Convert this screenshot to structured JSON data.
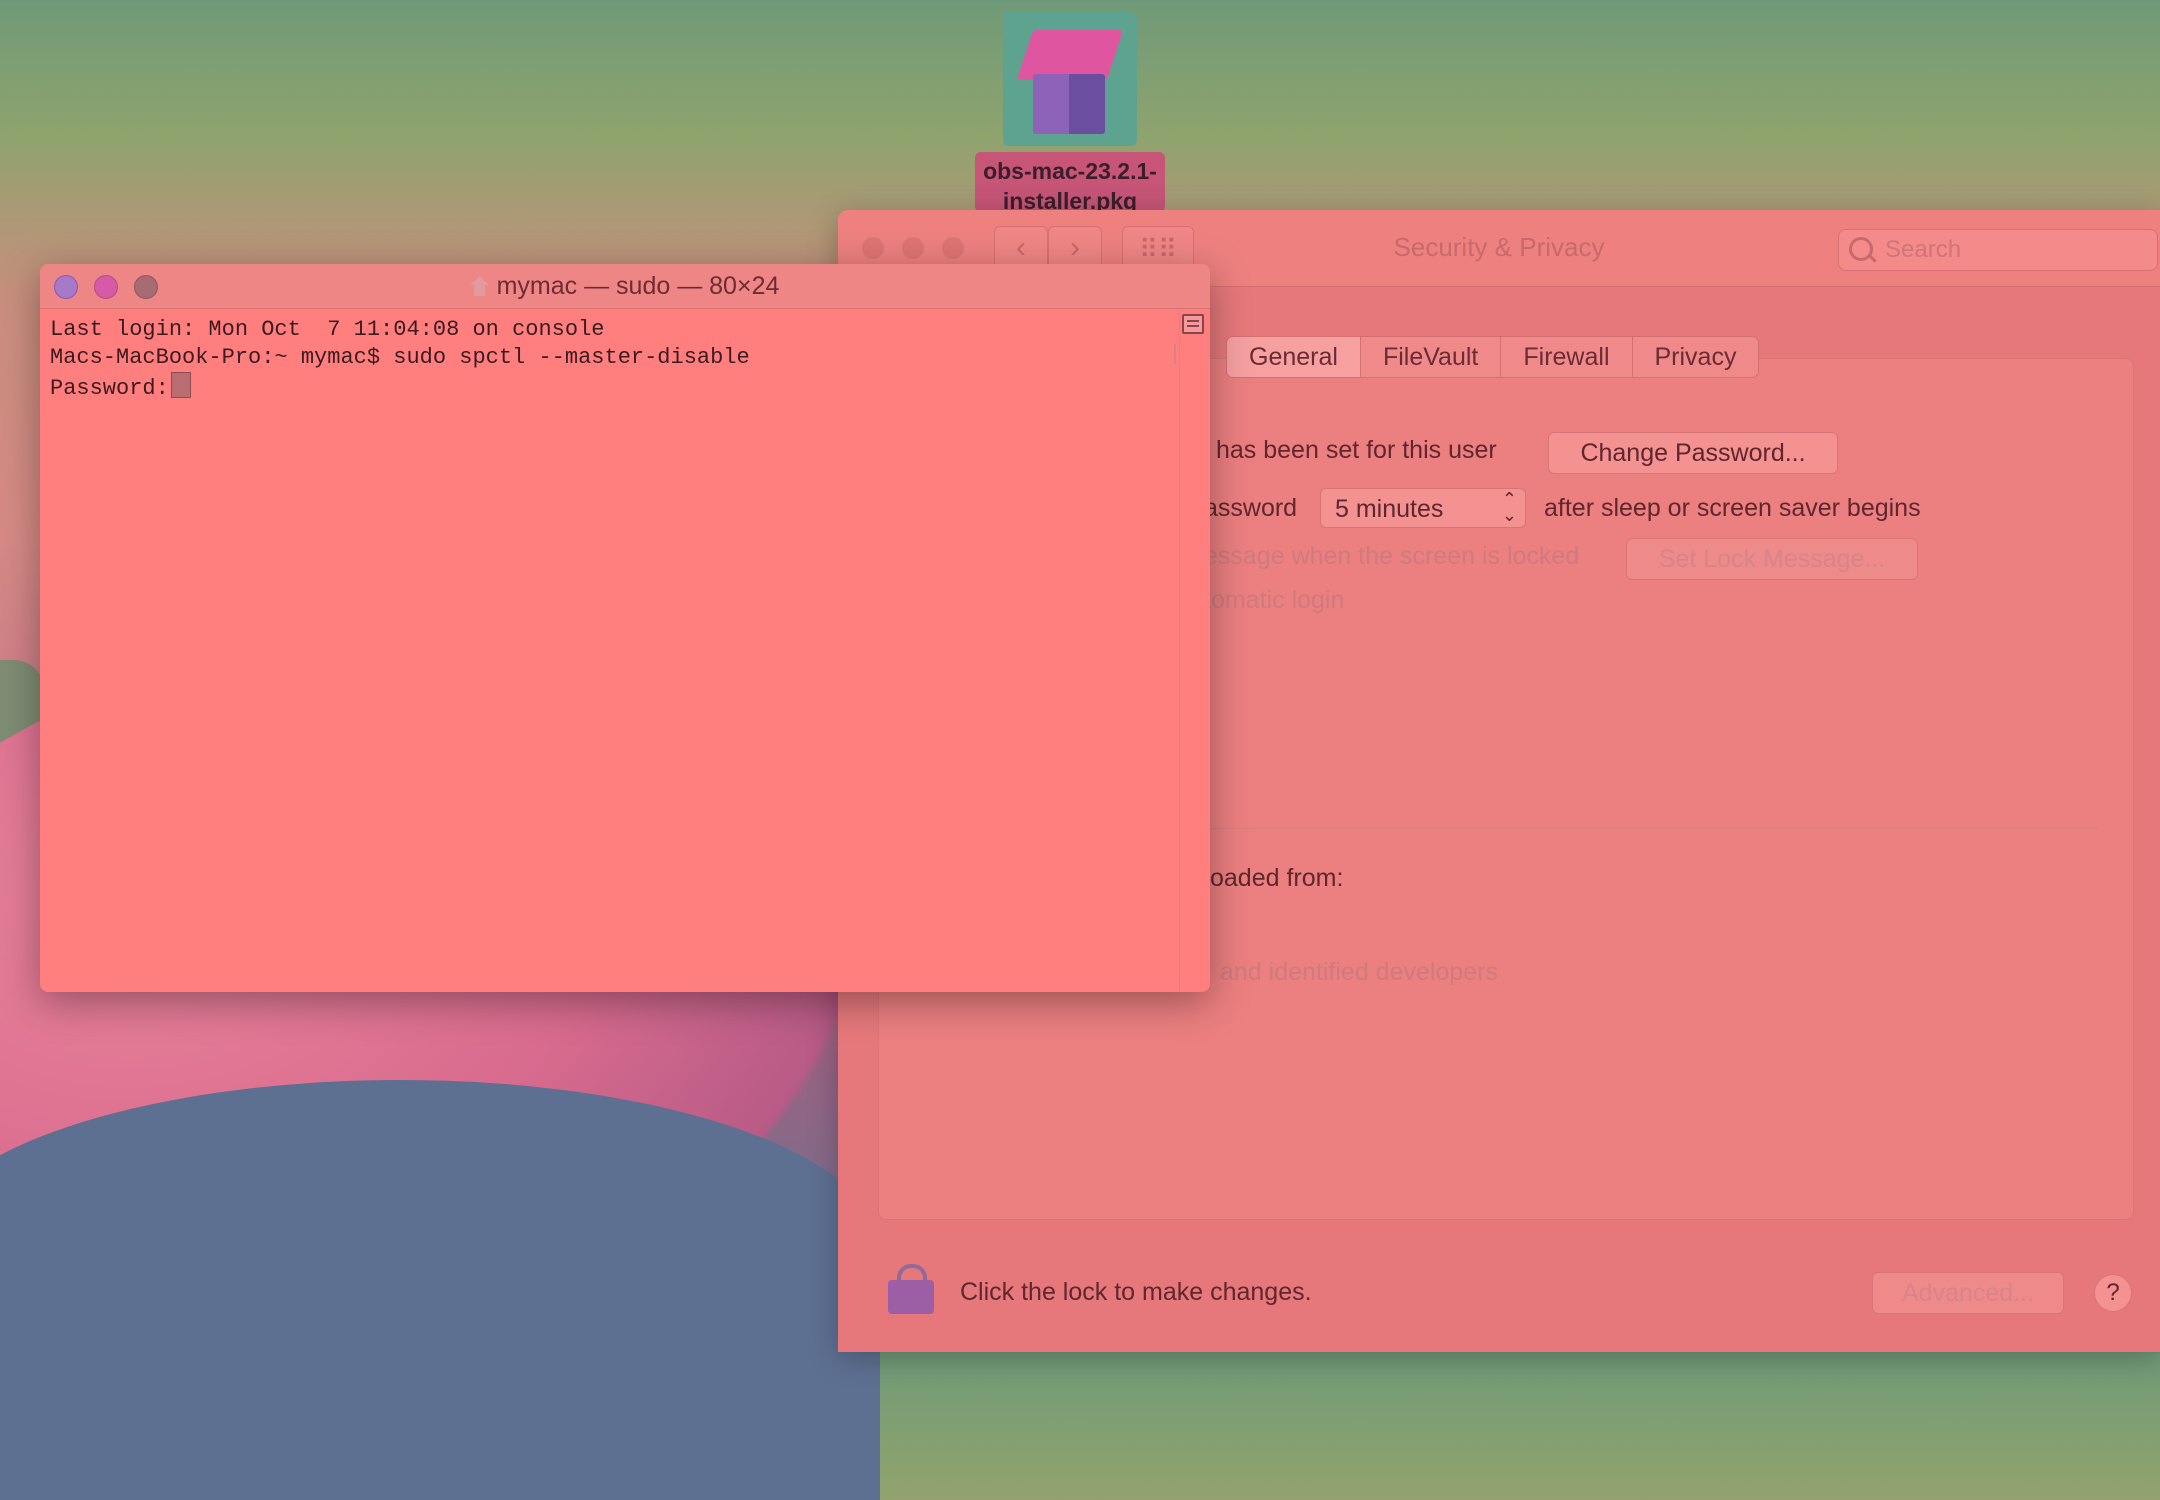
{
  "desktop": {
    "icon_label": "obs-mac-23.2.1-\ninstaller.pkg"
  },
  "security_privacy": {
    "title": "Security & Privacy",
    "search_placeholder": "Search",
    "tabs": [
      "General",
      "FileVault",
      "Firewall",
      "Privacy"
    ],
    "active_tab": "General",
    "password_set_text": "has been set for this user",
    "change_password_button": "Change Password...",
    "require_password_text": "assword",
    "delay_select_value": "5 minutes",
    "after_sleep_text": "after sleep or screen saver begins",
    "lock_message_text": "essage when the screen is locked",
    "set_lock_message_button": "Set Lock Message...",
    "auto_login_text": "tomatic login",
    "downloaded_from_text": "oaded from:",
    "identified_devs_text": "and identified developers",
    "lock_hint": "Click the lock to make changes.",
    "advanced_button": "Advanced...",
    "help_button": "?"
  },
  "terminal": {
    "title": "mymac — sudo — 80×24",
    "lines": [
      "Last login: Mon Oct  7 11:04:08 on console",
      "Macs-MacBook-Pro:~ mymac$ sudo spctl --master-disable",
      "Password:"
    ]
  }
}
